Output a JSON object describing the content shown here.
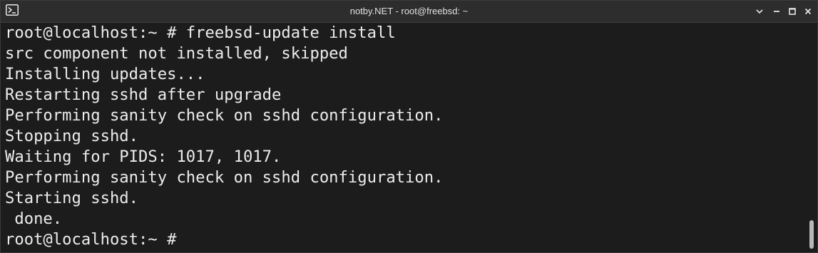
{
  "window": {
    "title": "notby.NET - root@freebsd: ~"
  },
  "icons": {
    "app": "terminal-icon",
    "menu": "chevron-down-icon",
    "minimize": "minimize-icon",
    "maximize": "maximize-icon",
    "close": "close-icon"
  },
  "terminal": {
    "lines": [
      "root@localhost:~ # freebsd-update install",
      "src component not installed, skipped",
      "Installing updates...",
      "Restarting sshd after upgrade",
      "Performing sanity check on sshd configuration.",
      "Stopping sshd.",
      "Waiting for PIDS: 1017, 1017.",
      "Performing sanity check on sshd configuration.",
      "Starting sshd.",
      " done.",
      "root@localhost:~ # "
    ]
  },
  "colors": {
    "background": "#1c1c1c",
    "titlebar": "#2d2d2d",
    "text": "#ececec"
  }
}
